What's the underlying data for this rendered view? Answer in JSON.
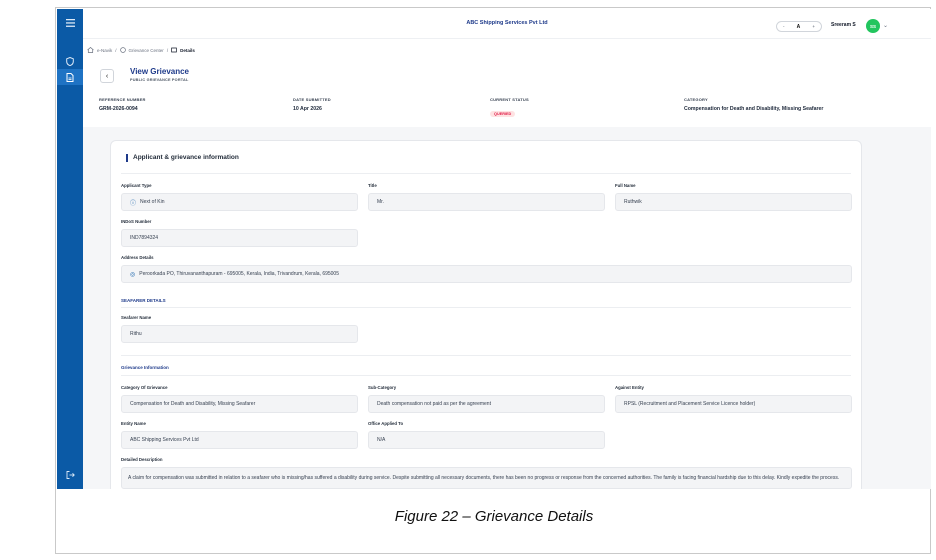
{
  "sidebar": {
    "icons": [
      "menu-icon",
      "shield-icon",
      "document-icon",
      "logout-icon"
    ]
  },
  "header": {
    "company": "ABC Shipping Services Pvt Ltd",
    "font_minus": "-",
    "font_a": "A",
    "font_plus": "+",
    "user_name": "Sreeram S",
    "avatar_initials": "SS"
  },
  "breadcrumb": {
    "home": "e-Navik",
    "sep": "/",
    "grievance_center": "Grievance Center",
    "current": "Details"
  },
  "page": {
    "title": "View Grievance",
    "subtitle": "PUBLIC GRIEVANCE PORTAL"
  },
  "summary": {
    "reference_label": "REFERENCE NUMBER",
    "reference_value": "GRM-2026-0094",
    "date_label": "DATE SUBMITTED",
    "date_value": "10 Apr 2026",
    "status_label": "CURRENT STATUS",
    "status_value": "QUERIED",
    "category_label": "CATEGORY",
    "category_value": "Compensation for Death and Disability, Missing Seafarer"
  },
  "card": {
    "title": "Applicant & grievance information",
    "applicant_type_label": "Applicant Type",
    "applicant_type": "Next of Kin",
    "title_label": "Title",
    "title_value": "Mr.",
    "full_name_label": "Full Name",
    "full_name": "Ruthwik",
    "indos_label": "INDoS Number",
    "indos": "IND7894324",
    "address_label": "Address Details",
    "address": "Peroorkada PO, Thiruvananthapuram - 695005, Kerala, India, Trivandrum, Kerala, 695005",
    "seafarer_section": "SEAFARER DETAILS",
    "seafarer_name_label": "Seafarer Name",
    "seafarer_name": "Rithu",
    "grievance_section": "Grievance Information",
    "category_label": "Category Of Grievance",
    "category": "Compensation for Death and Disability, Missing Seafarer",
    "subcategory_label": "Sub-Category",
    "subcategory": "Death compensation not paid as per the agreement",
    "against_label": "Against Entity",
    "against": "RPSL (Recruitment and Placement Service Licence holder)",
    "entity_name_label": "Entity Name",
    "entity_name": "ABC Shipping Services Pvt Ltd",
    "office_label": "Office Applied To",
    "office": "N/A",
    "description_label": "Detailed Description",
    "description": "A claim for compensation was submitted in relation to a seafarer who is missing/has suffered a disability during service. Despite submitting all necessary documents, there has been no progress or response from the concerned authorities. The family is facing financial hardship due to this delay. Kindly expedite the process."
  },
  "caption": "Figure 22 – Grievance  Details"
}
